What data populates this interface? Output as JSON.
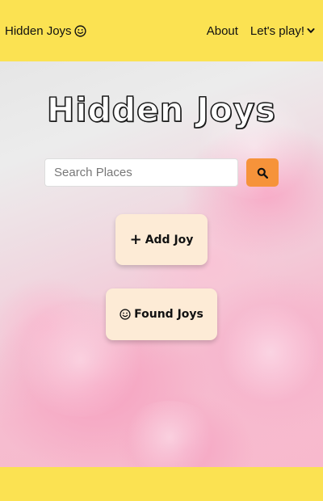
{
  "navbar": {
    "brand": "Hidden Joys",
    "brand_icon": "smile-icon",
    "about_label": "About",
    "dropdown_label": "Let's play!",
    "dropdown_icon": "chevron-down-icon",
    "background_color": "#fbe252"
  },
  "hero": {
    "title": "Hidden Joys",
    "search": {
      "placeholder": "Search Places",
      "button_icon": "search-icon",
      "button_color": "#f6933a"
    },
    "add_joy_label": "Add Joy",
    "add_joy_icon": "plus-icon",
    "found_joys_label": "Found Joys",
    "found_joys_icon": "smile-icon",
    "button_color": "#fdebd6"
  },
  "footer": {
    "background_color": "#fbe252"
  }
}
